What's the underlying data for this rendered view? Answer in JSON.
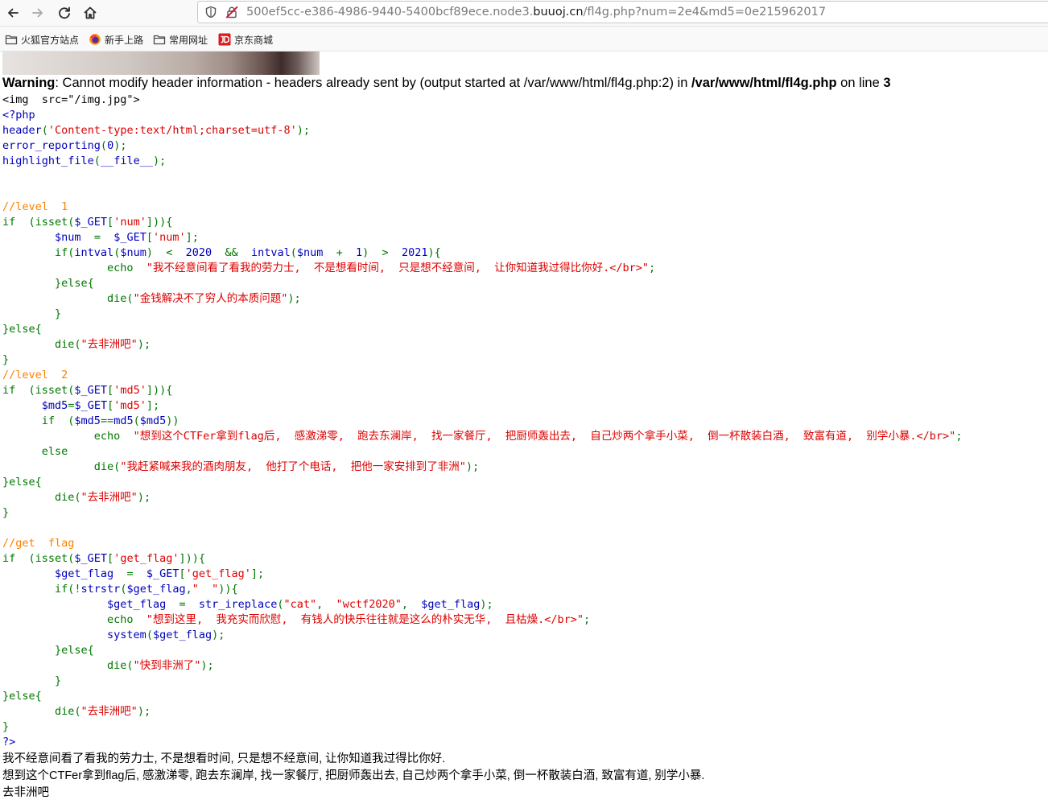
{
  "browser": {
    "url": {
      "prefix": "500ef5cc-e386-4986-9440-5400bcf89ece.node3.",
      "domain": "buuoj.cn",
      "path": "/fl4g.php?num=2e4&md5=0e215962017"
    },
    "bookmarks": [
      {
        "label": "火狐官方站点",
        "icon": "folder-icon"
      },
      {
        "label": "新手上路",
        "icon": "firefox-icon"
      },
      {
        "label": "常用网址",
        "icon": "folder-icon"
      },
      {
        "label": "京东商城",
        "icon": "jd-icon"
      }
    ]
  },
  "warning": {
    "label": "Warning",
    "message": ": Cannot modify header information - headers already sent by (output started at /var/www/html/fl4g.php:2) in ",
    "file": "/var/www/html/fl4g.php",
    "on_line": " on line ",
    "line_no": "3"
  },
  "code_lines": [
    [
      {
        "t": "<img  src=\"/img.jpg\">",
        "c": "h"
      }
    ],
    [
      {
        "t": "<?php",
        "c": "d"
      }
    ],
    [
      {
        "t": "header",
        "c": "d"
      },
      {
        "t": "(",
        "c": "k"
      },
      {
        "t": "'Content-type:text/html;charset=utf-8'",
        "c": "s"
      },
      {
        "t": ");",
        "c": "k"
      }
    ],
    [
      {
        "t": "error_reporting",
        "c": "d"
      },
      {
        "t": "(",
        "c": "k"
      },
      {
        "t": "0",
        "c": "d"
      },
      {
        "t": ");",
        "c": "k"
      }
    ],
    [
      {
        "t": "highlight_file",
        "c": "d"
      },
      {
        "t": "(",
        "c": "k"
      },
      {
        "t": "__file__",
        "c": "d"
      },
      {
        "t": ");",
        "c": "k"
      }
    ],
    [],
    [],
    [
      {
        "t": "//level  1",
        "c": "c"
      }
    ],
    [
      {
        "t": "if  (isset(",
        "c": "k"
      },
      {
        "t": "$_GET",
        "c": "d"
      },
      {
        "t": "[",
        "c": "k"
      },
      {
        "t": "'num'",
        "c": "s"
      },
      {
        "t": "])){",
        "c": "k"
      }
    ],
    [
      {
        "t": "        ",
        "c": "d"
      },
      {
        "t": "$num  ",
        "c": "d"
      },
      {
        "t": "=  ",
        "c": "k"
      },
      {
        "t": "$_GET",
        "c": "d"
      },
      {
        "t": "[",
        "c": "k"
      },
      {
        "t": "'num'",
        "c": "s"
      },
      {
        "t": "];",
        "c": "k"
      }
    ],
    [
      {
        "t": "        ",
        "c": "d"
      },
      {
        "t": "if(",
        "c": "k"
      },
      {
        "t": "intval",
        "c": "d"
      },
      {
        "t": "(",
        "c": "k"
      },
      {
        "t": "$num",
        "c": "d"
      },
      {
        "t": ")  <  ",
        "c": "k"
      },
      {
        "t": "2020  ",
        "c": "d"
      },
      {
        "t": "&&  ",
        "c": "k"
      },
      {
        "t": "intval",
        "c": "d"
      },
      {
        "t": "(",
        "c": "k"
      },
      {
        "t": "$num  ",
        "c": "d"
      },
      {
        "t": "+  ",
        "c": "k"
      },
      {
        "t": "1",
        "c": "d"
      },
      {
        "t": ")  >  ",
        "c": "k"
      },
      {
        "t": "2021",
        "c": "d"
      },
      {
        "t": "){",
        "c": "k"
      }
    ],
    [
      {
        "t": "                ",
        "c": "d"
      },
      {
        "t": "echo  ",
        "c": "k"
      },
      {
        "t": "\"我不经意间看了看我的劳力士,  不是想看时间,  只是想不经意间,  让你知道我过得比你好.</br>\"",
        "c": "s"
      },
      {
        "t": ";",
        "c": "k"
      }
    ],
    [
      {
        "t": "        }else{",
        "c": "k"
      }
    ],
    [
      {
        "t": "                ",
        "c": "d"
      },
      {
        "t": "die(",
        "c": "k"
      },
      {
        "t": "\"金钱解决不了穷人的本质问题\"",
        "c": "s"
      },
      {
        "t": ");",
        "c": "k"
      }
    ],
    [
      {
        "t": "        }",
        "c": "k"
      }
    ],
    [
      {
        "t": "}else{",
        "c": "k"
      }
    ],
    [
      {
        "t": "        ",
        "c": "d"
      },
      {
        "t": "die(",
        "c": "k"
      },
      {
        "t": "\"去非洲吧\"",
        "c": "s"
      },
      {
        "t": ");",
        "c": "k"
      }
    ],
    [
      {
        "t": "}",
        "c": "k"
      }
    ],
    [
      {
        "t": "//level  2",
        "c": "c"
      }
    ],
    [
      {
        "t": "if  (isset(",
        "c": "k"
      },
      {
        "t": "$_GET",
        "c": "d"
      },
      {
        "t": "[",
        "c": "k"
      },
      {
        "t": "'md5'",
        "c": "s"
      },
      {
        "t": "])){",
        "c": "k"
      }
    ],
    [
      {
        "t": "      ",
        "c": "d"
      },
      {
        "t": "$md5",
        "c": "d"
      },
      {
        "t": "=",
        "c": "k"
      },
      {
        "t": "$_GET",
        "c": "d"
      },
      {
        "t": "[",
        "c": "k"
      },
      {
        "t": "'md5'",
        "c": "s"
      },
      {
        "t": "];",
        "c": "k"
      }
    ],
    [
      {
        "t": "      ",
        "c": "d"
      },
      {
        "t": "if  (",
        "c": "k"
      },
      {
        "t": "$md5",
        "c": "d"
      },
      {
        "t": "==",
        "c": "k"
      },
      {
        "t": "md5",
        "c": "d"
      },
      {
        "t": "(",
        "c": "k"
      },
      {
        "t": "$md5",
        "c": "d"
      },
      {
        "t": "))",
        "c": "k"
      }
    ],
    [
      {
        "t": "              ",
        "c": "d"
      },
      {
        "t": "echo  ",
        "c": "k"
      },
      {
        "t": "\"想到这个CTFer拿到flag后,  感激涕零,  跑去东澜岸,  找一家餐厅,  把厨师轰出去,  自己炒两个拿手小菜,  倒一杯散装白酒,  致富有道,  别学小暴.</br>\"",
        "c": "s"
      },
      {
        "t": ";",
        "c": "k"
      }
    ],
    [
      {
        "t": "      else",
        "c": "k"
      }
    ],
    [
      {
        "t": "              ",
        "c": "d"
      },
      {
        "t": "die(",
        "c": "k"
      },
      {
        "t": "\"我赶紧喊来我的酒肉朋友,  他打了个电话,  把他一家安排到了非洲\"",
        "c": "s"
      },
      {
        "t": ");",
        "c": "k"
      }
    ],
    [
      {
        "t": "}else{",
        "c": "k"
      }
    ],
    [
      {
        "t": "        ",
        "c": "d"
      },
      {
        "t": "die(",
        "c": "k"
      },
      {
        "t": "\"去非洲吧\"",
        "c": "s"
      },
      {
        "t": ");",
        "c": "k"
      }
    ],
    [
      {
        "t": "}",
        "c": "k"
      }
    ],
    [],
    [
      {
        "t": "//get  flag",
        "c": "c"
      }
    ],
    [
      {
        "t": "if  (isset(",
        "c": "k"
      },
      {
        "t": "$_GET",
        "c": "d"
      },
      {
        "t": "[",
        "c": "k"
      },
      {
        "t": "'get_flag'",
        "c": "s"
      },
      {
        "t": "])){",
        "c": "k"
      }
    ],
    [
      {
        "t": "        ",
        "c": "d"
      },
      {
        "t": "$get_flag  ",
        "c": "d"
      },
      {
        "t": "=  ",
        "c": "k"
      },
      {
        "t": "$_GET",
        "c": "d"
      },
      {
        "t": "[",
        "c": "k"
      },
      {
        "t": "'get_flag'",
        "c": "s"
      },
      {
        "t": "];",
        "c": "k"
      }
    ],
    [
      {
        "t": "        ",
        "c": "d"
      },
      {
        "t": "if(!",
        "c": "k"
      },
      {
        "t": "strstr",
        "c": "d"
      },
      {
        "t": "(",
        "c": "k"
      },
      {
        "t": "$get_flag",
        "c": "d"
      },
      {
        "t": ",",
        "c": "k"
      },
      {
        "t": "\"  \"",
        "c": "s"
      },
      {
        "t": ")){",
        "c": "k"
      }
    ],
    [
      {
        "t": "                ",
        "c": "d"
      },
      {
        "t": "$get_flag  ",
        "c": "d"
      },
      {
        "t": "=  ",
        "c": "k"
      },
      {
        "t": "str_ireplace",
        "c": "d"
      },
      {
        "t": "(",
        "c": "k"
      },
      {
        "t": "\"cat\"",
        "c": "s"
      },
      {
        "t": ",  ",
        "c": "k"
      },
      {
        "t": "\"wctf2020\"",
        "c": "s"
      },
      {
        "t": ",  ",
        "c": "k"
      },
      {
        "t": "$get_flag",
        "c": "d"
      },
      {
        "t": ");",
        "c": "k"
      }
    ],
    [
      {
        "t": "                ",
        "c": "d"
      },
      {
        "t": "echo  ",
        "c": "k"
      },
      {
        "t": "\"想到这里,  我充实而欣慰,  有钱人的快乐往往就是这么的朴实无华,  且枯燥.</br>\"",
        "c": "s"
      },
      {
        "t": ";",
        "c": "k"
      }
    ],
    [
      {
        "t": "                ",
        "c": "d"
      },
      {
        "t": "system",
        "c": "d"
      },
      {
        "t": "(",
        "c": "k"
      },
      {
        "t": "$get_flag",
        "c": "d"
      },
      {
        "t": ");",
        "c": "k"
      }
    ],
    [
      {
        "t": "        }else{",
        "c": "k"
      }
    ],
    [
      {
        "t": "                ",
        "c": "d"
      },
      {
        "t": "die(",
        "c": "k"
      },
      {
        "t": "\"快到非洲了\"",
        "c": "s"
      },
      {
        "t": ");",
        "c": "k"
      }
    ],
    [
      {
        "t": "        }",
        "c": "k"
      }
    ],
    [
      {
        "t": "}else{",
        "c": "k"
      }
    ],
    [
      {
        "t": "        ",
        "c": "d"
      },
      {
        "t": "die(",
        "c": "k"
      },
      {
        "t": "\"去非洲吧\"",
        "c": "s"
      },
      {
        "t": ");",
        "c": "k"
      }
    ],
    [
      {
        "t": "}",
        "c": "k"
      }
    ],
    [
      {
        "t": "?>",
        "c": "d"
      }
    ]
  ],
  "output_lines": [
    "我不经意间看了看我的劳力士, 不是想看时间, 只是想不经意间, 让你知道我过得比你好.",
    "想到这个CTFer拿到flag后, 感激涕零, 跑去东澜岸, 找一家餐厅, 把厨师轰出去, 自己炒两个拿手小菜, 倒一杯散装白酒, 致富有道, 别学小暴.",
    "去非洲吧"
  ],
  "colors": {
    "keyword": "#007700",
    "string": "#dd0000",
    "comment": "#ff8000",
    "default": "#0000bb",
    "html": "#000000"
  }
}
